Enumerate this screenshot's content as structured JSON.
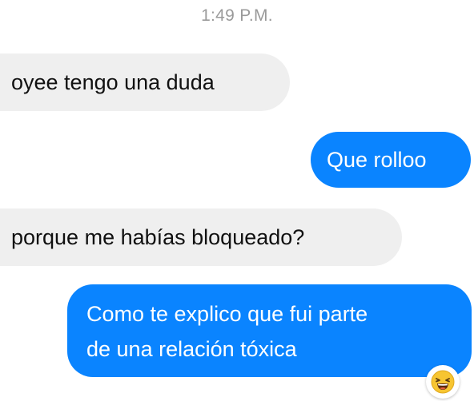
{
  "conversation": {
    "timestamp": "1:49 P.M.",
    "messages": [
      {
        "direction": "incoming",
        "text": "oyee tengo una duda"
      },
      {
        "direction": "outgoing",
        "text": "Que rolloo"
      },
      {
        "direction": "incoming",
        "text": "porque me habías bloqueado?"
      },
      {
        "direction": "outgoing",
        "lines": [
          "Como te explico que fui parte",
          "de una relación tóxica"
        ]
      }
    ],
    "reaction": {
      "icon": "laughing-emoji-icon"
    }
  },
  "colors": {
    "outgoing_bubble": "#0a84ff",
    "incoming_bubble": "#efefef",
    "timestamp_text": "#9a9a9a"
  }
}
